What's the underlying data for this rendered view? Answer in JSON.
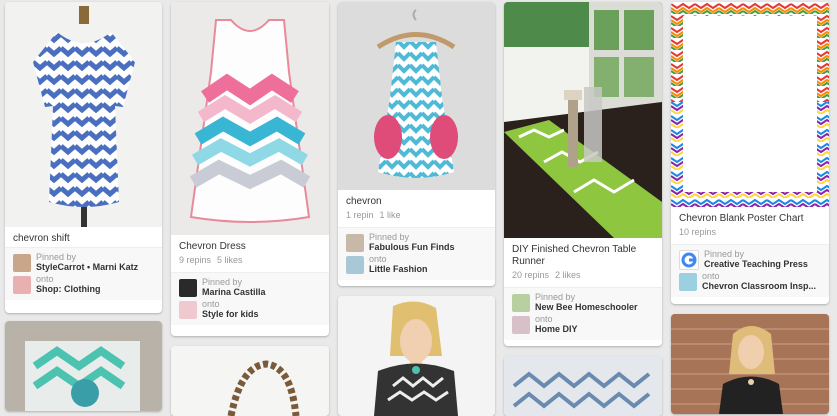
{
  "pins": [
    {
      "description": "chevron shift",
      "pinned_by_label": "Pinned by",
      "pinned_by": "StyleCarrot • Marni Katz",
      "onto_label": "onto",
      "board": "Shop: Clothing"
    },
    {
      "description": "Chevron Dress",
      "repins": "9 repins",
      "likes": "5 likes",
      "pinned_by_label": "Pinned by",
      "pinned_by": "Marina Castilla",
      "onto_label": "onto",
      "board": "Style for kids"
    },
    {
      "description": "chevron",
      "repins": "1 repin",
      "likes": "1 like",
      "pinned_by_label": "Pinned by",
      "pinned_by": "Fabulous Fun Finds",
      "onto_label": "onto",
      "board": "Little Fashion"
    },
    {
      "description": "DIY Finished Chevron Table Runner",
      "repins": "20 repins",
      "likes": "2 likes",
      "pinned_by_label": "Pinned by",
      "pinned_by": "New Bee Homeschooler",
      "onto_label": "onto",
      "board": "Home DIY"
    },
    {
      "description": "Chevron Blank Poster Chart",
      "repins": "10 repins",
      "pinned_by_label": "Pinned by",
      "pinned_by": "Creative Teaching Press",
      "onto_label": "onto",
      "board": "Chevron Classroom Insp..."
    }
  ],
  "colors": {
    "background": "#e9e9e9",
    "card": "#ffffff",
    "text": "#333333",
    "meta": "#999999"
  }
}
